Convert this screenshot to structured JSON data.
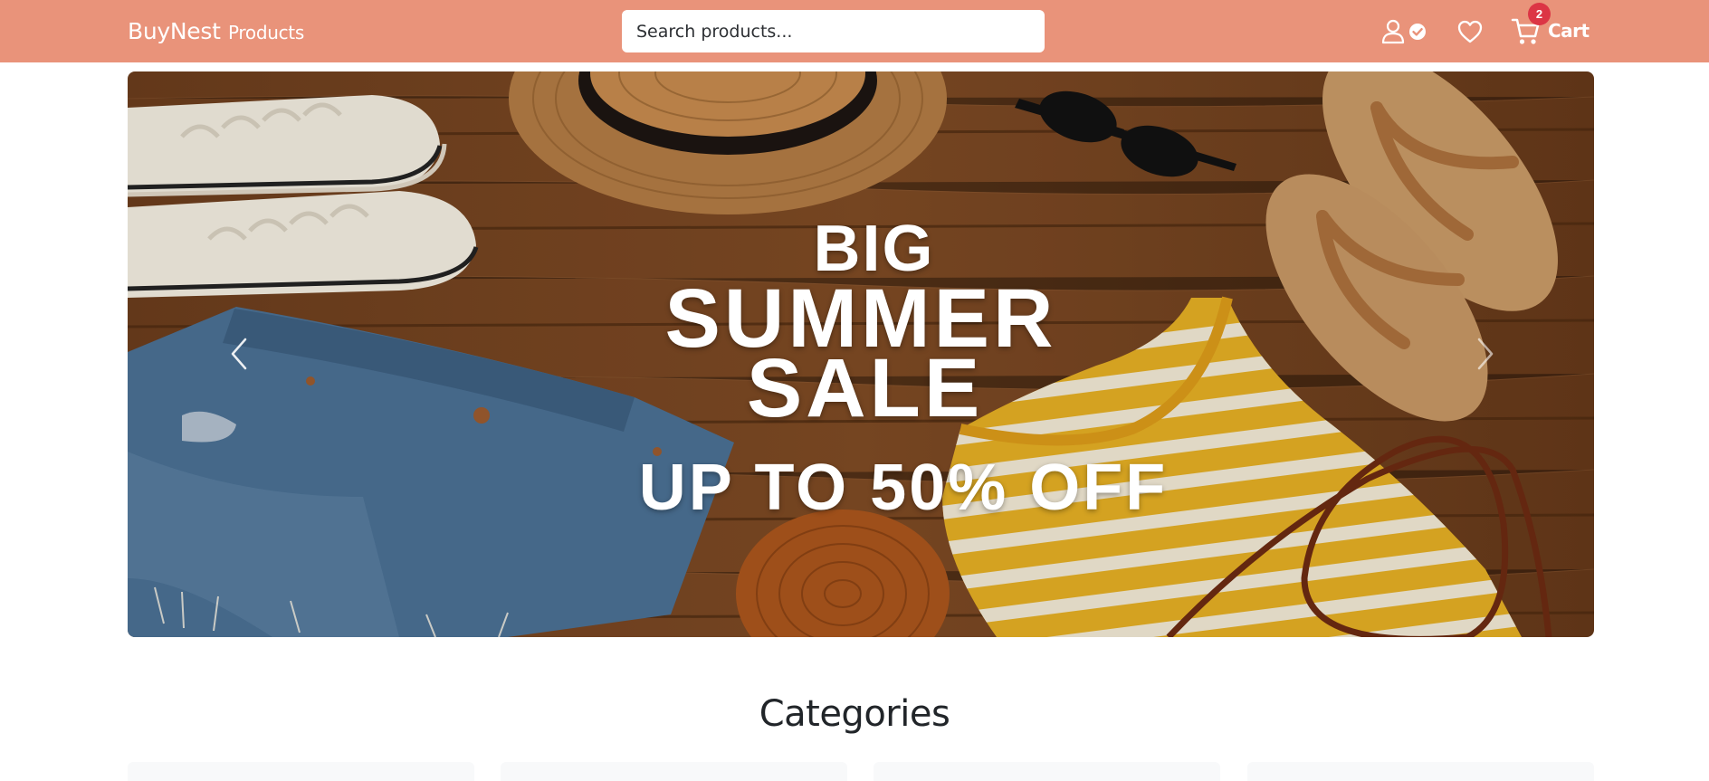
{
  "navbar": {
    "brand": "BuyNest",
    "links": [
      "Products"
    ],
    "search": {
      "placeholder": "Search products...",
      "value": ""
    },
    "icons": [
      "user-verified-icon",
      "heart-icon",
      "cart-icon"
    ],
    "cart": {
      "label": "Cart",
      "count": "2"
    },
    "colors": {
      "background": "#e9937a",
      "badge": "#dc3545"
    }
  },
  "hero": {
    "slides": [
      {
        "lines": [
          "BIG",
          "SUMMER",
          "SALE",
          "UP TO 50% OFF"
        ]
      }
    ],
    "controls": [
      "previous-slide",
      "next-slide"
    ]
  },
  "categories": {
    "title": "Categories",
    "cards": 4
  }
}
